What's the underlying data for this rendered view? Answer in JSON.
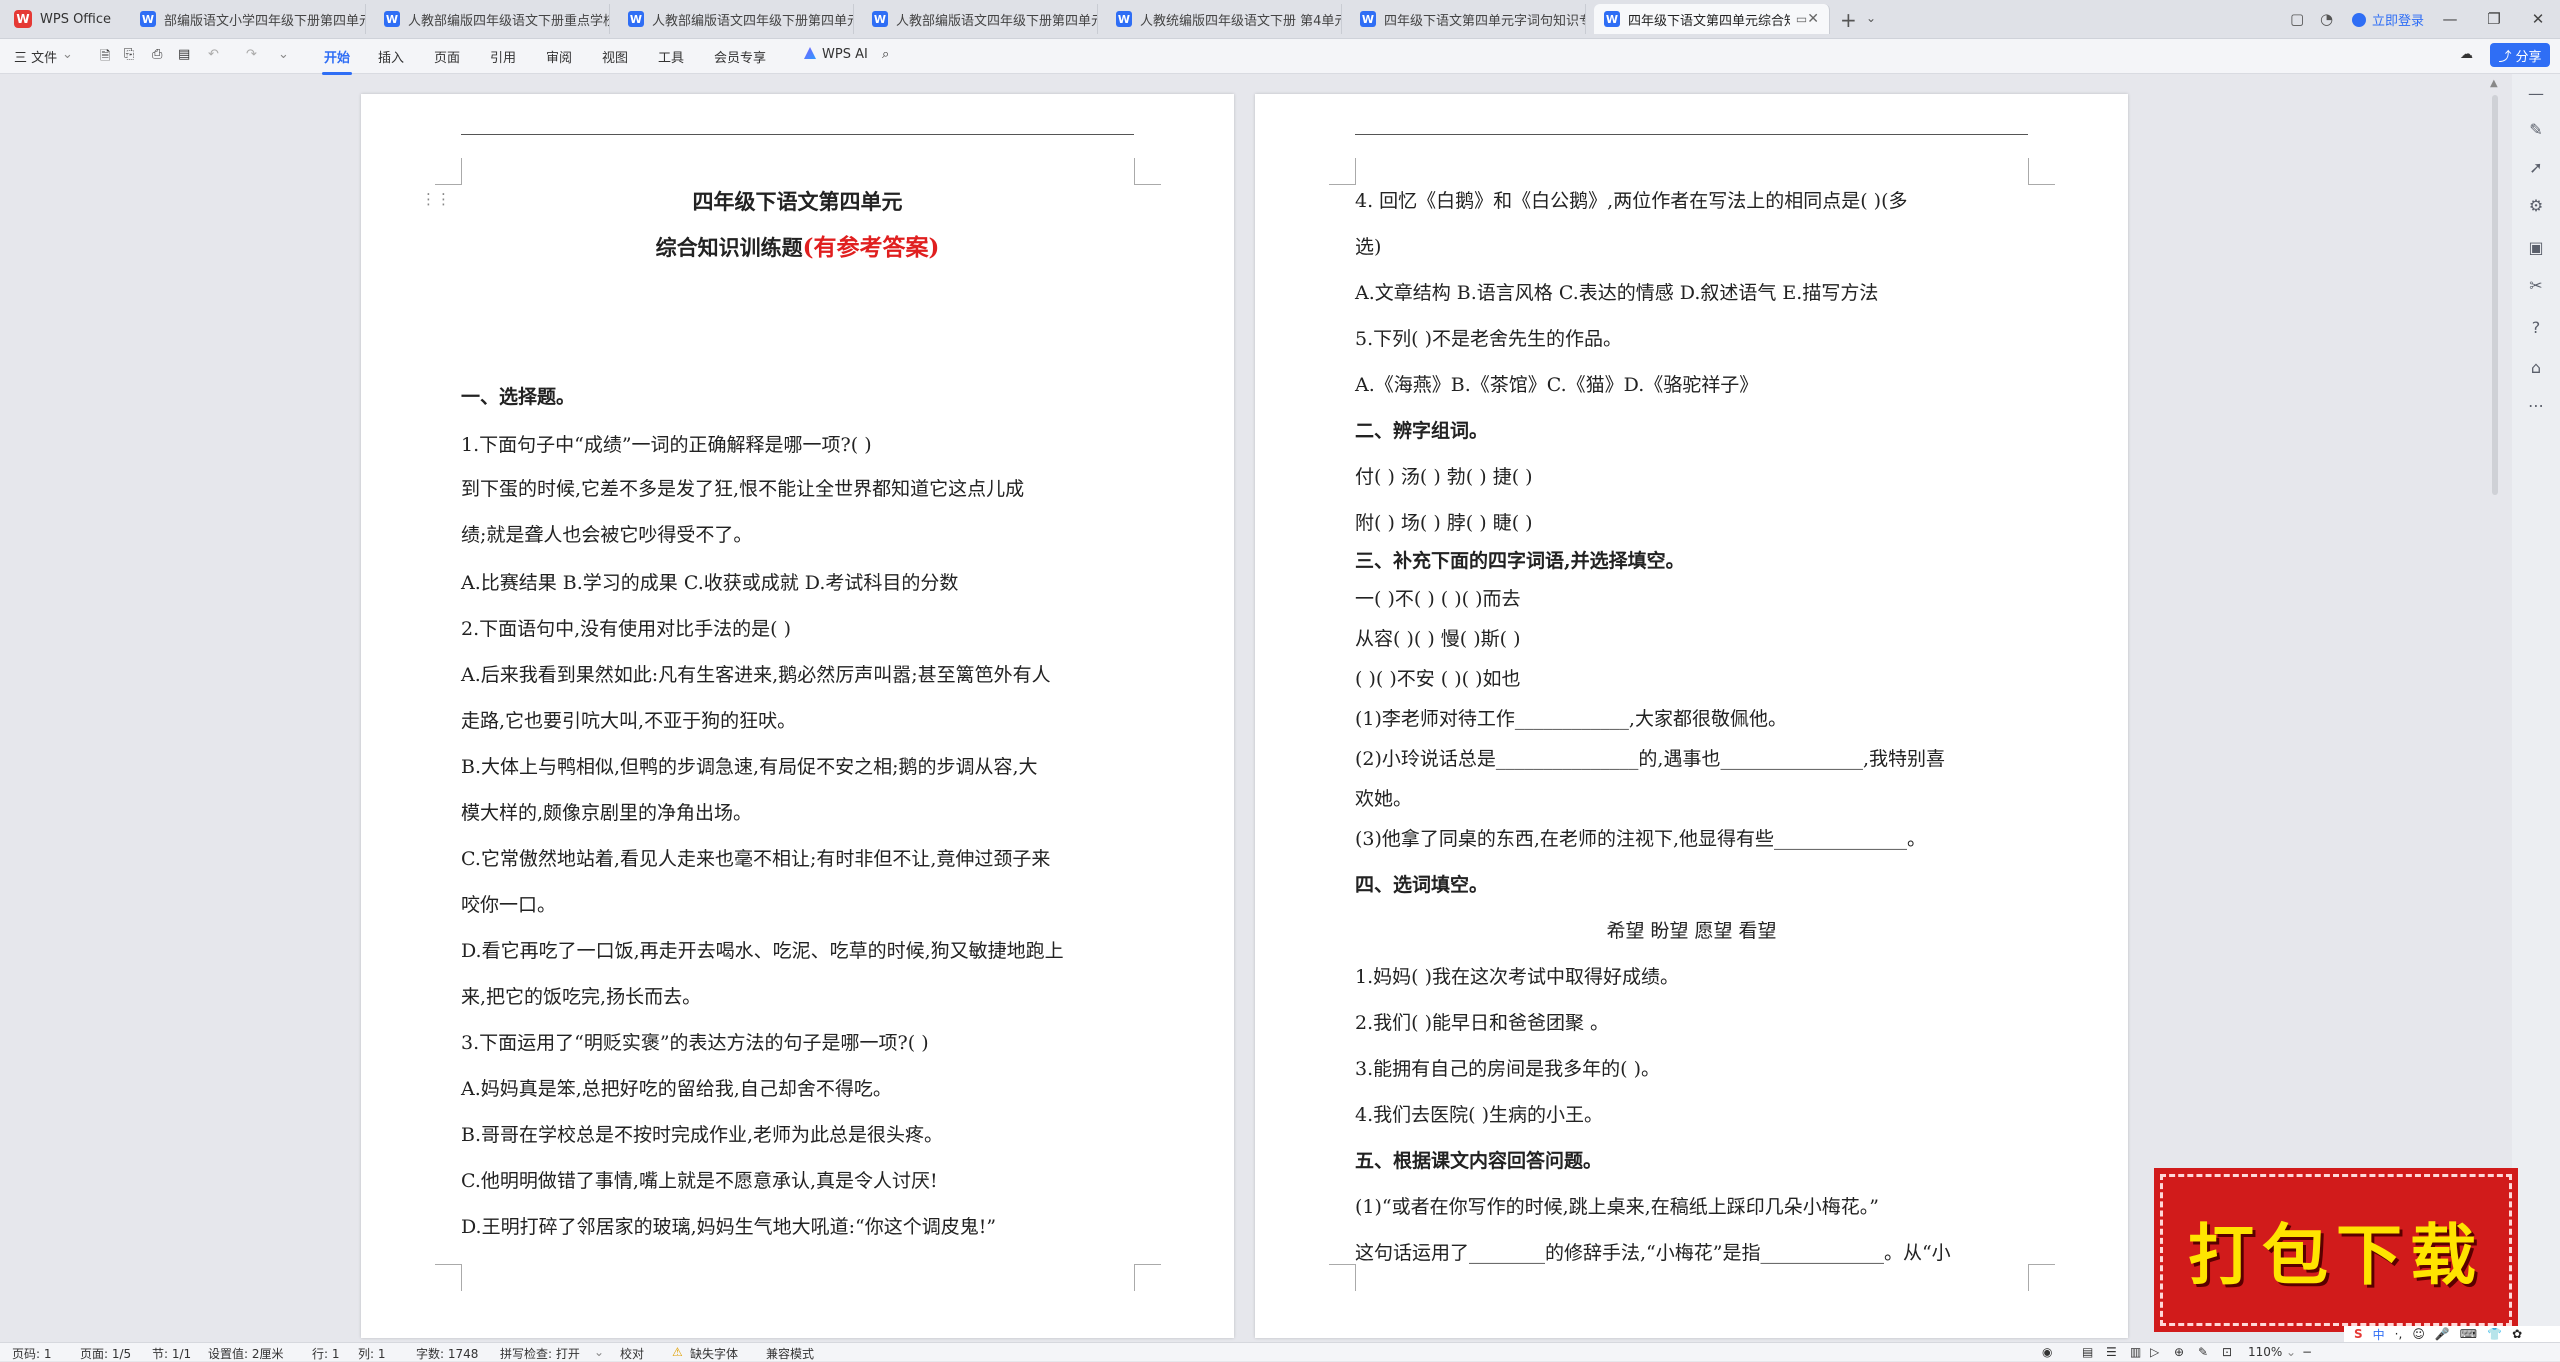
{
  "app": {
    "name": "WPS Office",
    "tabs": [
      "部编版语文小学四年级下册第四单元",
      "人教部编版四年级语文下册重点学校",
      "人教部编版语文四年级下册第四单元",
      "人教部编版语文四年级下册第四单元",
      "人教统编版四年级语文下册 第4单元",
      "四年级下语文第四单元字词句知识专",
      "四年级下语文第四单元综合知"
    ],
    "active_tab": 6,
    "login": "立即登录"
  },
  "ribbon": {
    "file": "三 文件",
    "menus": [
      "开始",
      "插入",
      "页面",
      "引用",
      "审阅",
      "视图",
      "工具",
      "会员专享"
    ],
    "active_menu": "开始",
    "ai": "WPS AI",
    "share": "分享"
  },
  "page1": {
    "title1": "四年级下语文第四单元",
    "title2a": "综合知识训练题",
    "title2b": "(有参考答案)",
    "lines": [
      {
        "t": "一、选择题。",
        "bold": true
      },
      {
        "t": "1.下面句子中“成绩”一词的正确解释是哪一项?(          )"
      },
      {
        "t": "        到下蛋的时候,它差不多是发了狂,恨不能让全世界都知道它这点儿成"
      },
      {
        "t": "绩;就是聋人也会被它吵得受不了。"
      },
      {
        "t": "A.比赛结果  B.学习的成果 C.收获或成就 D.考试科目的分数"
      },
      {
        "t": "2.下面语句中,没有使用对比手法的是(          )"
      },
      {
        "t": "A.后来我看到果然如此:凡有生客进来,鹅必然厉声叫嚣;甚至篱笆外有人"
      },
      {
        "t": "走路,它也要引吭大叫,不亚于狗的狂吠。"
      },
      {
        "t": "B.大体上与鸭相似,但鸭的步调急速,有局促不安之相;鹅的步调从容,大"
      },
      {
        "t": "模大样的,颇像京剧里的净角出场。"
      },
      {
        "t": "C.它常傲然地站着,看见人走来也毫不相让;有时非但不让,竟伸过颈子来"
      },
      {
        "t": "咬你一口。"
      },
      {
        "t": "D.看它再吃了一口饭,再走开去喝水、吃泥、吃草的时候,狗又敏捷地跑上"
      },
      {
        "t": "来,把它的饭吃完,扬长而去。"
      },
      {
        "t": "3.下面运用了“明贬实褒”的表达方法的句子是哪一项?(          )"
      },
      {
        "t": "A.妈妈真是笨,总把好吃的留给我,自己却舍不得吃。"
      },
      {
        "t": "B.哥哥在学校总是不按时完成作业,老师为此总是很头疼。"
      },
      {
        "t": "C.他明明做错了事情,嘴上就是不愿意承认,真是令人讨厌!"
      },
      {
        "t": "D.王明打碎了邻居家的玻璃,妈妈生气地大吼道:“你这个调皮鬼!”"
      }
    ]
  },
  "page2": {
    "lines": [
      {
        "t": "4.  回忆《白鹅》和《白公鹅》,两位作者在写法上的相同点是(    )(多"
      },
      {
        "t": "选)"
      },
      {
        "t": "A.文章结构  B.语言风格  C.表达的情感 D.叙述语气 E.描写方法"
      },
      {
        "t": "5.下列(        )不是老舍先生的作品。"
      },
      {
        "t": "A.《海燕》B.《茶馆》C.《猫》D.《骆驼祥子》"
      },
      {
        "t": "二、辨字组词。",
        "bold": true
      },
      {
        "t": "付(            )  汤(            )  勃(            )  捷(            )"
      },
      {
        "t": "附(            )  场(            )  脖(            )  睫(            )"
      },
      {
        "t": "三、补充下面的四字词语,并选择填空。",
        "bold": true
      },
      {
        "t": "一(      )不(      )             (      )(      )而去"
      },
      {
        "t": "从容(      )(      )             慢(      )斯(      )"
      },
      {
        "t": "(      )(      )不安             (      )(      )如也"
      },
      {
        "t": "(1)李老师对待工作____________,大家都很敬佩他。"
      },
      {
        "t": "(2)小玲说话总是_______________的,遇事也_______________,我特别喜"
      },
      {
        "t": "欢她。"
      },
      {
        "t": "(3)他拿了同桌的东西,在老师的注视下,他显得有些______________。"
      },
      {
        "t": "四、选词填空。",
        "bold": true
      },
      {
        "t": "希望      盼望      愿望      看望",
        "center": true
      },
      {
        "t": "1.妈妈(         )我在这次考试中取得好成绩。"
      },
      {
        "t": "2.我们(         )能早日和爸爸团聚 。"
      },
      {
        "t": "3.能拥有自己的房间是我多年的(         )。"
      },
      {
        "t": "4.我们去医院(          )生病的小王。"
      },
      {
        "t": "五、根据课文内容回答问题。",
        "bold": true
      },
      {
        "t": " (1)“或者在你写作的时候,跳上桌来,在稿纸上踩印几朵小梅花。”"
      },
      {
        "t": "这句话运用了________的修辞手法,“小梅花”是指_____________。从“小"
      }
    ]
  },
  "banner": "打包下载",
  "status": {
    "page": "页码: 1",
    "pages": "页面: 1/5",
    "section": "节: 1/1",
    "setting": "设置值: 2厘米",
    "row": "行: 1",
    "col": "列: 1",
    "words": "字数: 1748",
    "spell": "拼写检查: 打开",
    "proof": "校对",
    "font_missing": "缺失字体",
    "compat": "兼容模式",
    "zoom": "110%"
  },
  "ime": {
    "s": "S",
    "lang": "中",
    "items": [
      "·,",
      "☺",
      "🎤",
      "⌨",
      "👕",
      "✿"
    ]
  }
}
